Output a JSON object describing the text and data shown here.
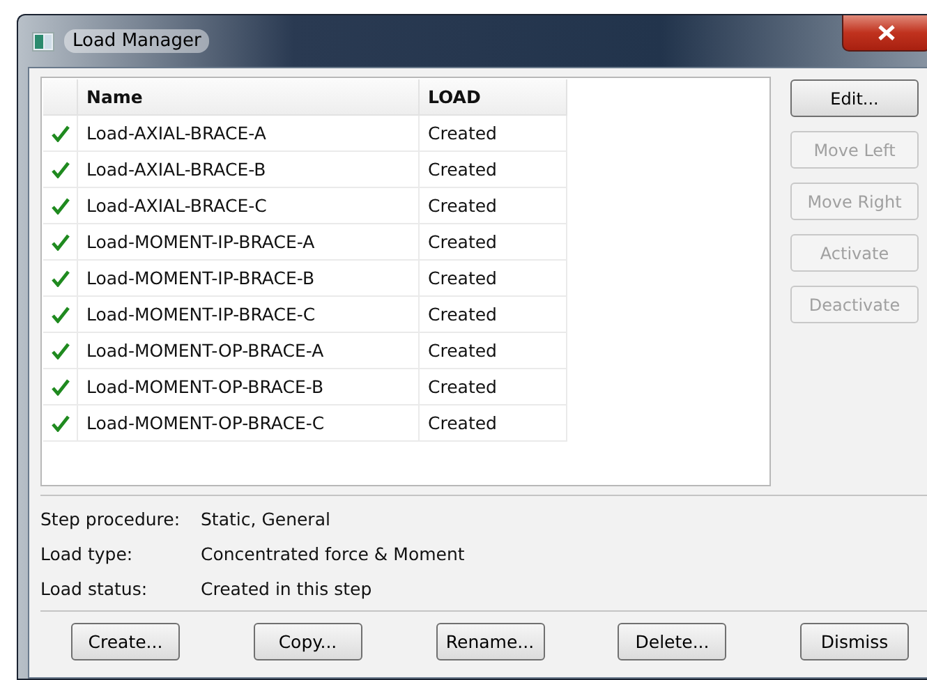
{
  "window": {
    "title": "Load Manager"
  },
  "table": {
    "columns": [
      "Name",
      "LOAD"
    ],
    "rows": [
      {
        "active": true,
        "name": "Load-AXIAL-BRACE-A",
        "load": "Created"
      },
      {
        "active": true,
        "name": "Load-AXIAL-BRACE-B",
        "load": "Created"
      },
      {
        "active": true,
        "name": "Load-AXIAL-BRACE-C",
        "load": "Created"
      },
      {
        "active": true,
        "name": "Load-MOMENT-IP-BRACE-A",
        "load": "Created"
      },
      {
        "active": true,
        "name": "Load-MOMENT-IP-BRACE-B",
        "load": "Created"
      },
      {
        "active": true,
        "name": "Load-MOMENT-IP-BRACE-C",
        "load": "Created"
      },
      {
        "active": true,
        "name": "Load-MOMENT-OP-BRACE-A",
        "load": "Created"
      },
      {
        "active": true,
        "name": "Load-MOMENT-OP-BRACE-B",
        "load": "Created"
      },
      {
        "active": true,
        "name": "Load-MOMENT-OP-BRACE-C",
        "load": "Created"
      }
    ]
  },
  "side_buttons": [
    {
      "label": "Edit...",
      "disabled": false
    },
    {
      "label": "Move Left",
      "disabled": true
    },
    {
      "label": "Move Right",
      "disabled": true
    },
    {
      "label": "Activate",
      "disabled": true
    },
    {
      "label": "Deactivate",
      "disabled": true
    }
  ],
  "info": [
    {
      "label": "Step procedure:",
      "value": "Static, General"
    },
    {
      "label": "Load type:",
      "value": "Concentrated force & Moment"
    },
    {
      "label": "Load status:",
      "value": "Created in this step"
    }
  ],
  "buttons": [
    "Create...",
    "Copy...",
    "Rename...",
    "Delete...",
    "Dismiss"
  ]
}
